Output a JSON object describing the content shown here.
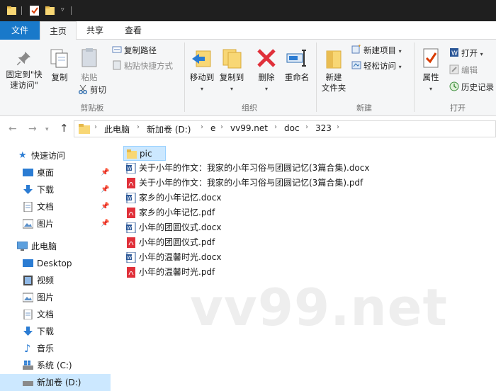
{
  "tabs": {
    "file": "文件",
    "home": "主页",
    "share": "共享",
    "view": "查看"
  },
  "ribbon": {
    "pin_quick_access": "固定到\"快\n速访问\"",
    "copy": "复制",
    "paste": "粘贴",
    "copy_path": "复制路径",
    "paste_shortcut": "粘贴快捷方式",
    "cut": "剪切",
    "clipboard_group": "剪贴板",
    "move_to": "移动到",
    "copy_to": "复制到",
    "delete": "删除",
    "rename": "重命名",
    "organize_group": "组织",
    "new_folder": "新建\n文件夹",
    "new_item": "新建项目",
    "easy_access": "轻松访问",
    "new_group": "新建",
    "properties": "属性",
    "open": "打开",
    "edit": "编辑",
    "history": "历史记录",
    "open_group": "打开"
  },
  "address": {
    "crumbs": [
      "此电脑",
      "新加卷 (D:)",
      "e",
      "vv99.net",
      "doc",
      "323"
    ]
  },
  "nav": {
    "quick_access": "快速访问",
    "desktop_pinned": "桌面",
    "downloads_pinned": "下载",
    "documents_pinned": "文档",
    "pictures_pinned": "图片",
    "this_pc": "此电脑",
    "desktop": "Desktop",
    "videos": "视频",
    "pictures": "图片",
    "documents": "文档",
    "downloads": "下载",
    "music": "音乐",
    "system_c": "系统 (C:)",
    "new_volume_d": "新加卷 (D:)"
  },
  "files": [
    {
      "name": "pic",
      "type": "folder"
    },
    {
      "name": "关于小年的作文：我家的小年习俗与团圆记忆(3篇合集).docx",
      "type": "docx"
    },
    {
      "name": "关于小年的作文：我家的小年习俗与团圆记忆(3篇合集).pdf",
      "type": "pdf"
    },
    {
      "name": "家乡的小年记忆.docx",
      "type": "docx"
    },
    {
      "name": "家乡的小年记忆.pdf",
      "type": "pdf"
    },
    {
      "name": "小年的团圆仪式.docx",
      "type": "docx"
    },
    {
      "name": "小年的团圆仪式.pdf",
      "type": "pdf"
    },
    {
      "name": "小年的温馨时光.docx",
      "type": "docx"
    },
    {
      "name": "小年的温馨时光.pdf",
      "type": "pdf"
    }
  ],
  "watermark": "vv99.net",
  "colors": {
    "accent": "#1979ca",
    "selection": "#cce8ff",
    "folder": "#f8d775",
    "pdf": "#e0303a",
    "word": "#2b5797"
  }
}
